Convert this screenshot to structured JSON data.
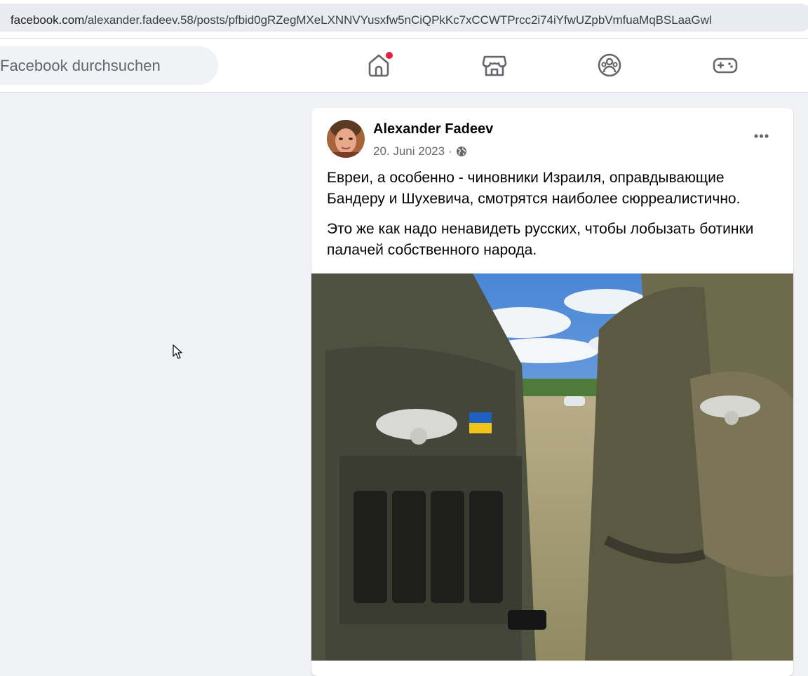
{
  "browser": {
    "url_domain": "facebook.com",
    "url_path": "/alexander.fadeev.58/posts/pfbid0gRZegMXeLXNNVYusxfw5nCiQPkKc7xCCWTPrcc2i74iYfwUZpbVmfuaMqBSLaaGwl",
    "site_info_icon": "tune-icon"
  },
  "header": {
    "search_placeholder": "Facebook durchsuchen",
    "nav": [
      {
        "name": "home-icon",
        "active_notification": true
      },
      {
        "name": "marketplace-icon"
      },
      {
        "name": "groups-icon"
      },
      {
        "name": "gaming-icon"
      }
    ],
    "colors": {
      "notification": "#e41e3f",
      "icon": "#65676b"
    }
  },
  "post": {
    "author": "Alexander Fadeev",
    "date": "20. Juni 2023",
    "separator": "·",
    "audience_icon": "globe-icon",
    "more_icon": "more-dots-icon",
    "paragraphs": [
      "Евреи, а особенно - чиновники Израиля, оправдывающие Бандеру и Шухевича, смотрятся наиболее сюрреалистично.",
      "Это же как надо ненавидеть русских, чтобы лобызать ботинки палачей собственного народа."
    ],
    "photo_icon": "post-photo"
  },
  "cursor_icon": "mouse-pointer-icon"
}
